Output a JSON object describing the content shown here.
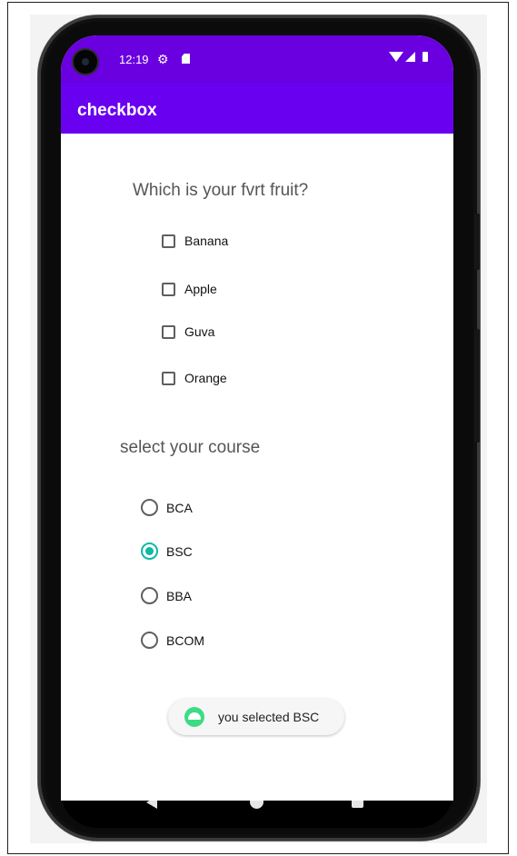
{
  "status_bar": {
    "time": "12:19",
    "icons": [
      "settings-icon",
      "sd-card-icon",
      "wifi-icon",
      "signal-icon",
      "battery-icon"
    ]
  },
  "app_bar": {
    "title": "checkbox",
    "color": "#6a00f0"
  },
  "fruit_section": {
    "question": "Which is your fvrt fruit?",
    "options": [
      {
        "label": "Banana",
        "checked": false
      },
      {
        "label": "Apple",
        "checked": false
      },
      {
        "label": "Guva",
        "checked": false
      },
      {
        "label": "Orange",
        "checked": false
      }
    ]
  },
  "course_section": {
    "title": "select your course",
    "options": [
      {
        "label": "BCA",
        "selected": false
      },
      {
        "label": "BSC",
        "selected": true
      },
      {
        "label": "BBA",
        "selected": false
      },
      {
        "label": "BCOM",
        "selected": false
      }
    ],
    "accent_color": "#0fb7a8"
  },
  "toast": {
    "text": "you selected BSC"
  },
  "nav_bar": {
    "icons": [
      "back-icon",
      "home-icon",
      "recents-icon"
    ]
  }
}
